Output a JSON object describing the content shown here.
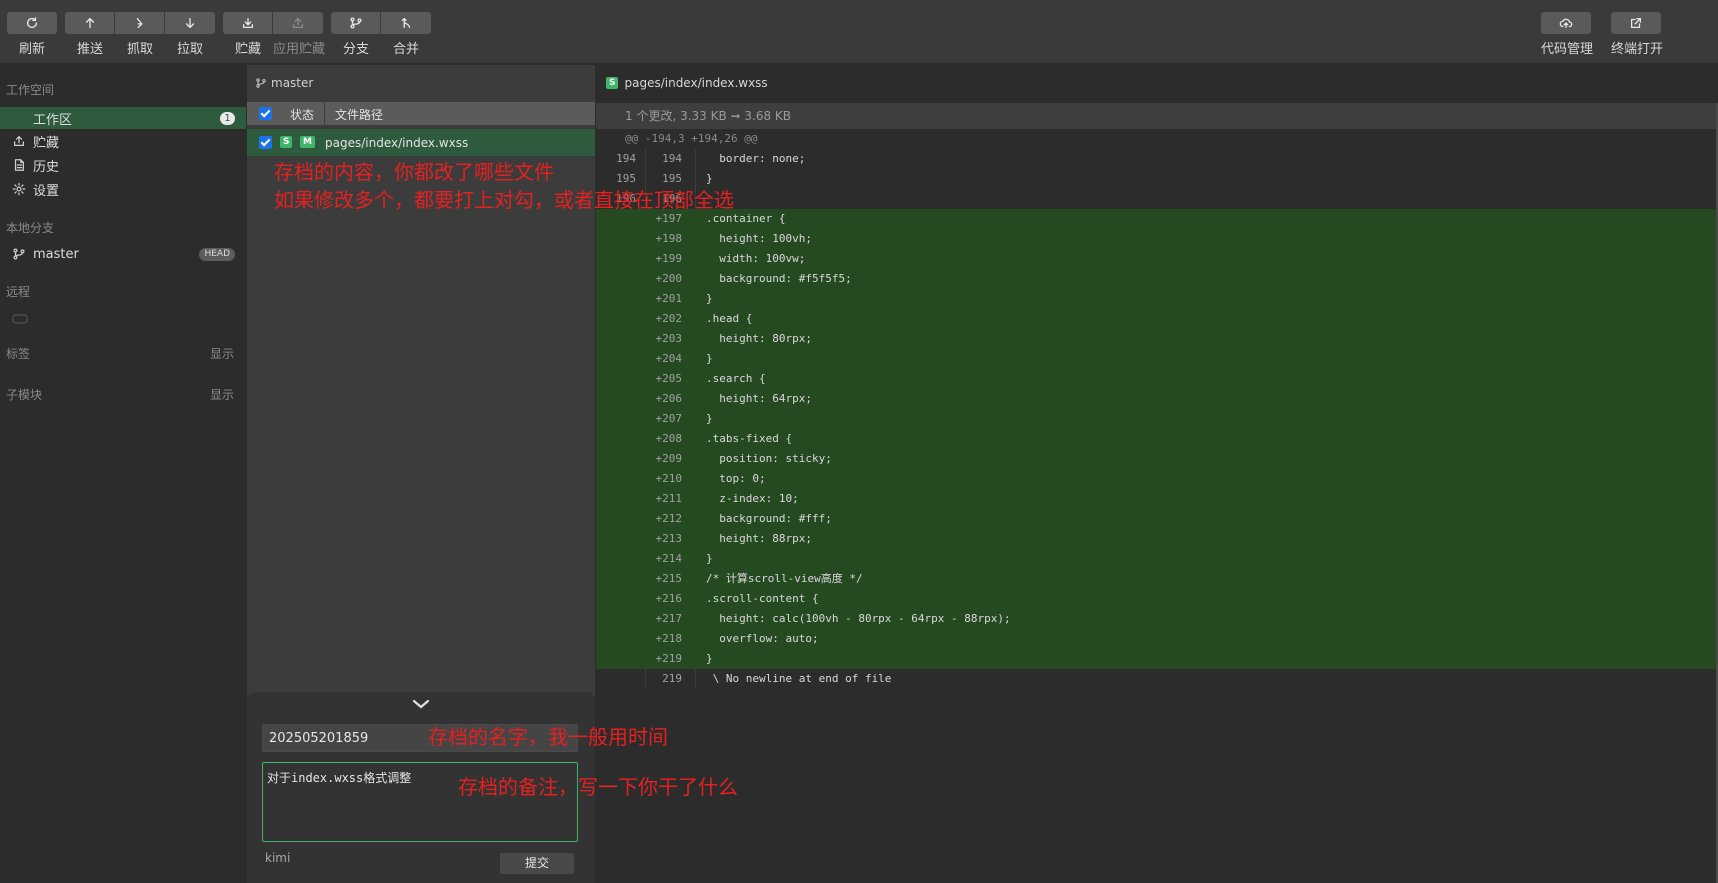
{
  "toolbar": {
    "refresh": "刷新",
    "push": "推送",
    "fetch": "抓取",
    "pull": "拉取",
    "stash": "贮藏",
    "apply_stash": "应用贮藏",
    "branch": "分支",
    "merge": "合并",
    "code_manage": "代码管理",
    "terminal_open": "终端打开"
  },
  "sidebar": {
    "workspace_title": "工作空间",
    "items": [
      {
        "label": "工作区",
        "badge": "1",
        "icon": "workspace"
      },
      {
        "label": "贮藏",
        "icon": "stash-icon"
      },
      {
        "label": "历史",
        "icon": "history-icon"
      },
      {
        "label": "设置",
        "icon": "gear-icon"
      }
    ],
    "local_branch_title": "本地分支",
    "branch": {
      "name": "master",
      "badge": "HEAD"
    },
    "remote_title": "远程",
    "tags_title": "标签",
    "tags_action": "显示",
    "submodule_title": "子模块",
    "submodule_action": "显示"
  },
  "files": {
    "branch": "master",
    "col_status": "状态",
    "col_path": "文件路径",
    "row": {
      "tag_s": "S",
      "tag_m": "M",
      "path": "pages/index/index.wxss",
      "checked": true
    }
  },
  "commit": {
    "title_value": "202505201859",
    "desc_value": "对于index.wxss格式调整",
    "author": "kimi",
    "submit": "提交"
  },
  "diff": {
    "tab_tag": "S",
    "tab_path": "pages/index/index.wxss",
    "stat": "1 个更改, 3.33 KB ➞ 3.68 KB",
    "hunk": "@@ -194,3 +194,26 @@",
    "lines": [
      {
        "old": "194",
        "new": "194",
        "code": "  border: none;",
        "type": "ctx"
      },
      {
        "old": "195",
        "new": "195",
        "code": "}",
        "type": "ctx"
      },
      {
        "old": "196",
        "new": "196",
        "code": "",
        "type": "ctx"
      },
      {
        "old": "",
        "new": "+197",
        "code": ".container {",
        "type": "add"
      },
      {
        "old": "",
        "new": "+198",
        "code": "  height: 100vh;",
        "type": "add"
      },
      {
        "old": "",
        "new": "+199",
        "code": "  width: 100vw;",
        "type": "add"
      },
      {
        "old": "",
        "new": "+200",
        "code": "  background: #f5f5f5;",
        "type": "add"
      },
      {
        "old": "",
        "new": "+201",
        "code": "}",
        "type": "add"
      },
      {
        "old": "",
        "new": "+202",
        "code": ".head {",
        "type": "add"
      },
      {
        "old": "",
        "new": "+203",
        "code": "  height: 80rpx;",
        "type": "add"
      },
      {
        "old": "",
        "new": "+204",
        "code": "}",
        "type": "add"
      },
      {
        "old": "",
        "new": "+205",
        "code": ".search {",
        "type": "add"
      },
      {
        "old": "",
        "new": "+206",
        "code": "  height: 64rpx;",
        "type": "add"
      },
      {
        "old": "",
        "new": "+207",
        "code": "}",
        "type": "add"
      },
      {
        "old": "",
        "new": "+208",
        "code": ".tabs-fixed {",
        "type": "add"
      },
      {
        "old": "",
        "new": "+209",
        "code": "  position: sticky;",
        "type": "add"
      },
      {
        "old": "",
        "new": "+210",
        "code": "  top: 0;",
        "type": "add"
      },
      {
        "old": "",
        "new": "+211",
        "code": "  z-index: 10;",
        "type": "add"
      },
      {
        "old": "",
        "new": "+212",
        "code": "  background: #fff;",
        "type": "add"
      },
      {
        "old": "",
        "new": "+213",
        "code": "  height: 88rpx;",
        "type": "add"
      },
      {
        "old": "",
        "new": "+214",
        "code": "}",
        "type": "add"
      },
      {
        "old": "",
        "new": "+215",
        "code": "/* 计算scroll-view高度 */",
        "type": "add"
      },
      {
        "old": "",
        "new": "+216",
        "code": ".scroll-content {",
        "type": "add"
      },
      {
        "old": "",
        "new": "+217",
        "code": "  height: calc(100vh - 80rpx - 64rpx - 88rpx);",
        "type": "add"
      },
      {
        "old": "",
        "new": "+218",
        "code": "  overflow: auto;",
        "type": "add"
      },
      {
        "old": "",
        "new": "+219",
        "code": "}",
        "type": "add"
      },
      {
        "old": "",
        "new": "219",
        "code": " \\ No newline at end of file",
        "type": "ctx"
      }
    ]
  },
  "annotations": {
    "files_line1": "存档的内容，你都改了哪些文件",
    "files_line2": "如果修改多个，都要打上对勾，或者直接在顶部全选",
    "title_note": "存档的名字，我一般用时间",
    "desc_note": "存档的备注，写一下你干了什么"
  },
  "colors": {
    "accent": "#3fb56b",
    "active_row": "#2e5a3e",
    "added_line": "#254a22",
    "annotation": "#e62020"
  }
}
